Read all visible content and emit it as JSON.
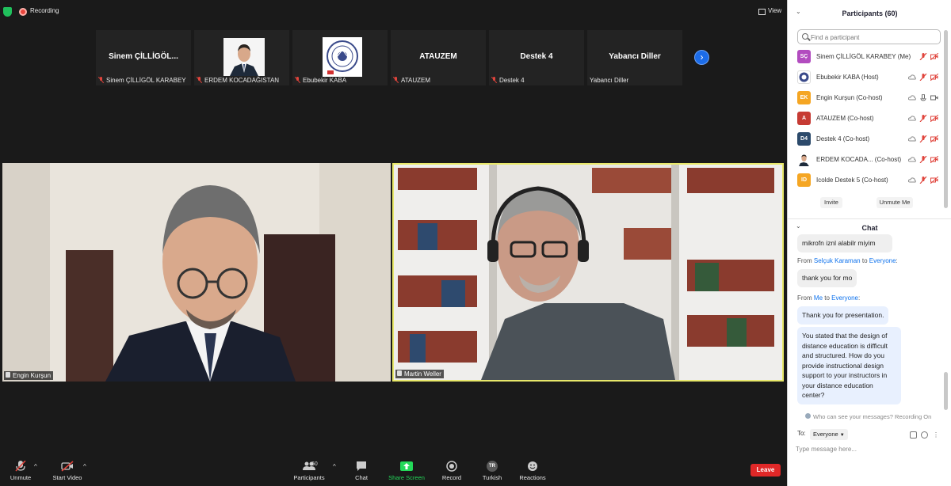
{
  "topbar": {
    "recording_label": "Recording",
    "view_label": "View"
  },
  "thumbnails": [
    {
      "name": "Sinem  ÇİLLİGÖL...",
      "label": "Sinem ÇİLLİGÖL KARABEY",
      "muted": true
    },
    {
      "name": "",
      "label": "ERDEM KOCADAĞISTAN",
      "muted": true,
      "photo": true
    },
    {
      "name": "",
      "label": "Ebubekir KABA",
      "muted": true,
      "logo": true
    },
    {
      "name": "ATAUZEM",
      "label": "ATAUZEM",
      "muted": true
    },
    {
      "name": "Destek 4",
      "label": "Destek 4",
      "muted": true
    },
    {
      "name": "Yabancı Diller",
      "label": "Yabancı Diller",
      "muted": false
    }
  ],
  "videos": {
    "left_label": "Engin Kurşun",
    "right_label": "Martin Weller"
  },
  "toolbar": {
    "unmute": "Unmute",
    "start_video": "Start Video",
    "participants_count": "60",
    "participants": "Participants",
    "chat": "Chat",
    "share_screen": "Share Screen",
    "record": "Record",
    "language_badge": "TR",
    "language": "Turkish",
    "reactions": "Reactions",
    "leave": "Leave"
  },
  "colors": {
    "accent_blue": "#0e72ed",
    "leave_red": "#e02828",
    "share_green": "#23d959",
    "speaker_border": "#e8e86a"
  },
  "participants_panel": {
    "title": "Participants (60)",
    "search_placeholder": "Find a participant",
    "list": [
      {
        "initials": "SÇ",
        "color": "#b24cbf",
        "name": "Sinem ÇİLLİGÖL KARABEY (Me)",
        "video_off": true
      },
      {
        "initials": "",
        "color": "#ffffff",
        "name": "Ebubekir KABA (Host)",
        "video_off": true,
        "logo": true
      },
      {
        "initials": "EK",
        "color": "#f5a623",
        "name": "Engin Kurşun (Co-host)",
        "video_off": false
      },
      {
        "initials": "A",
        "color": "#c63b34",
        "name": "ATAUZEM (Co-host)",
        "video_off": true
      },
      {
        "initials": "D4",
        "color": "#2c4a6b",
        "name": "Destek 4 (Co-host)",
        "video_off": true
      },
      {
        "initials": "",
        "color": "#ffffff",
        "name": "ERDEM KOCADA...   (Co-host)",
        "video_off": true,
        "photo": true
      },
      {
        "initials": "ID",
        "color": "#f5a623",
        "name": "Icolde Destek 5 (Co-host)",
        "video_off": true
      }
    ],
    "invite": "Invite",
    "unmute_me": "Unmute Me"
  },
  "chat": {
    "title": "Chat",
    "messages": [
      {
        "bubble": "mikrofn iznl alabilr miyim"
      },
      {
        "from": "From",
        "sender": "Selçuk Karaman",
        "to": "to",
        "recipient": "Everyone",
        "suffix": ":",
        "bubble": "thank you for mo"
      },
      {
        "from": "From",
        "sender": "Me",
        "to": "to",
        "recipient": "Everyone",
        "suffix": ":",
        "bubble": "Thank you for presentation."
      },
      {
        "bubble": "You stated that the design of distance education is difficult and structured. How do you provide instructional design support to your instructors in your distance education center?"
      }
    ],
    "notice": "Who can see your messages? Recording On",
    "to_label": "To:",
    "to_value": "Everyone",
    "input_placeholder": "Type message here..."
  }
}
